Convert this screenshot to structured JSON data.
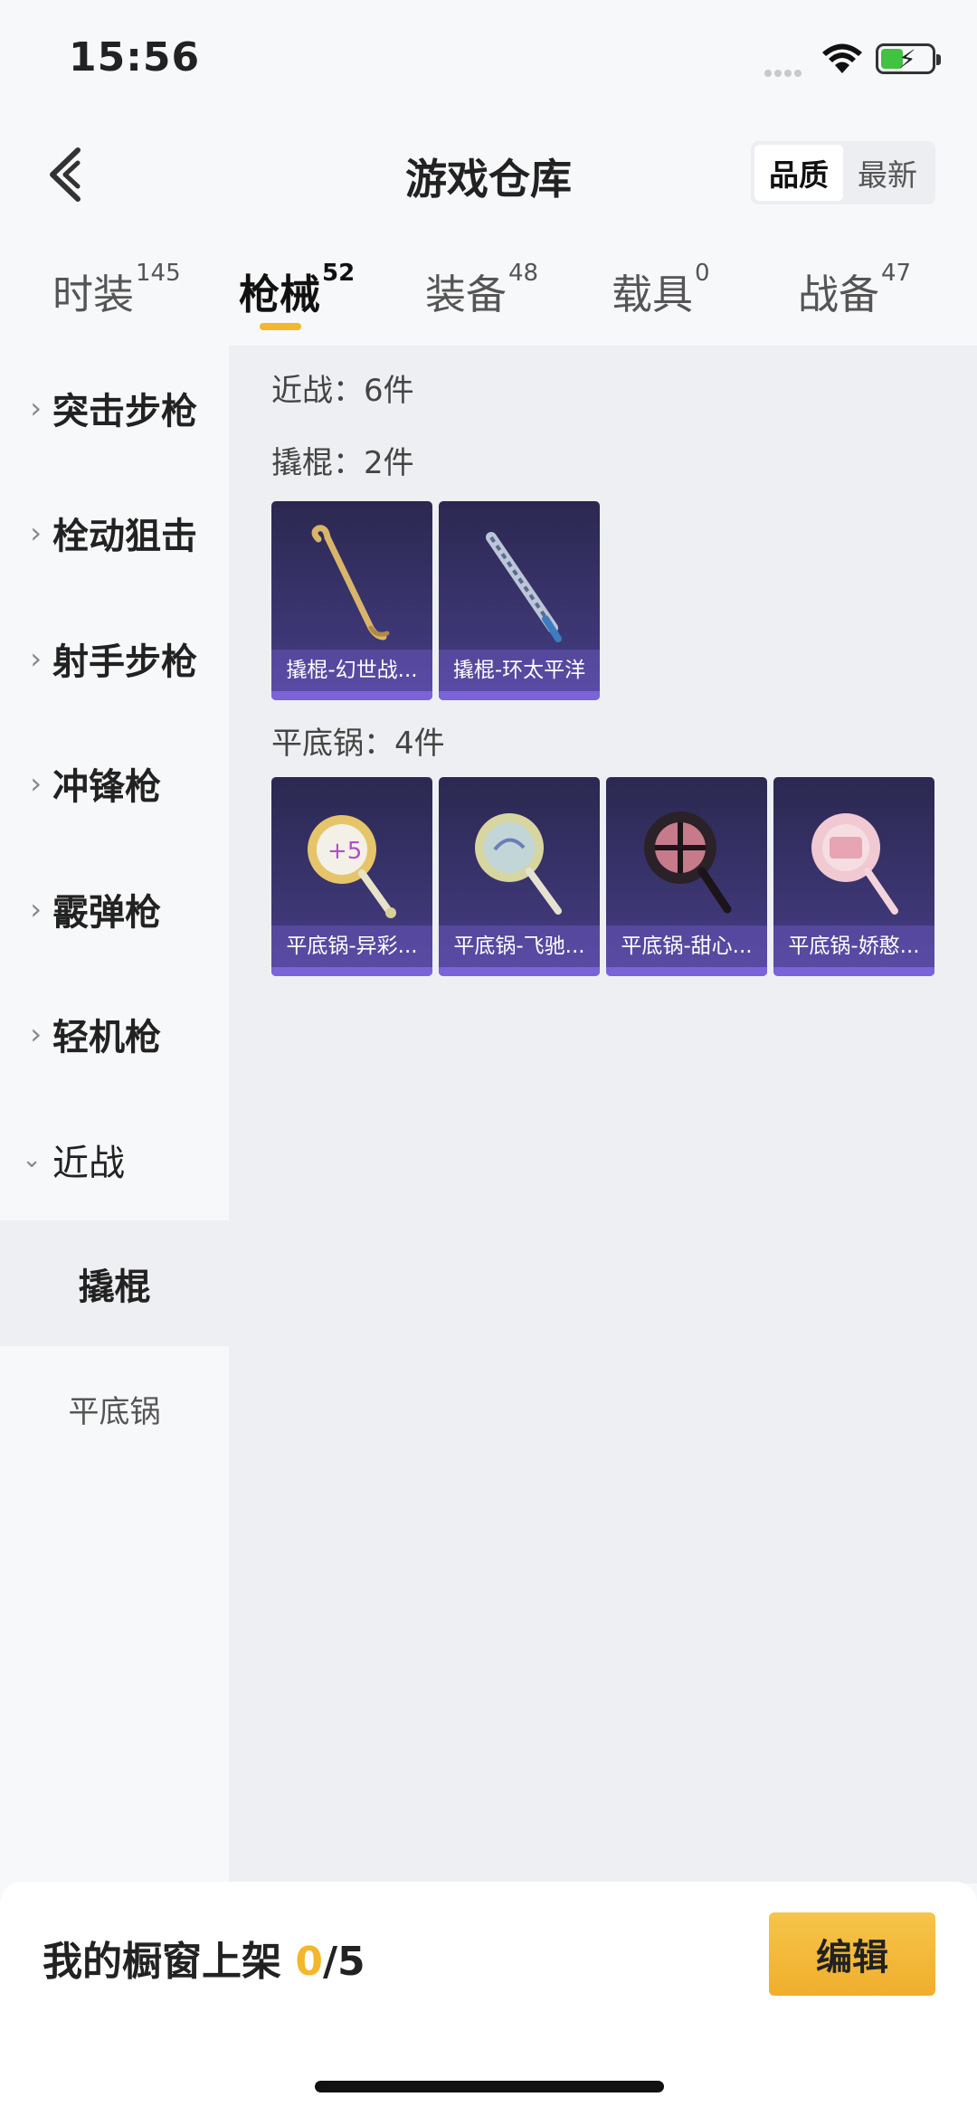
{
  "status_bar": {
    "time": "15:56"
  },
  "header": {
    "title": "游戏仓库",
    "sort": {
      "quality": "品质",
      "newest": "最新",
      "selected": "品质"
    }
  },
  "tabs": [
    {
      "label": "时装",
      "count": "145"
    },
    {
      "label": "枪械",
      "count": "52",
      "active": true
    },
    {
      "label": "装备",
      "count": "48"
    },
    {
      "label": "载具",
      "count": "0"
    },
    {
      "label": "战备",
      "count": "47"
    }
  ],
  "sidebar": {
    "categories": [
      "突击步枪",
      "栓动狙击",
      "射手步枪",
      "冲锋枪",
      "霰弹枪",
      "轻机枪",
      "近战"
    ],
    "subcategories": [
      "撬棍",
      "平底锅"
    ],
    "active_sub": "撬棍"
  },
  "content": {
    "melee_header": "近战：6件",
    "crowbar_header": "撬棍：2件",
    "pan_header": "平底锅：4件",
    "crowbars": [
      "撬棍-幻世战...",
      "撬棍-环太平洋"
    ],
    "pans": [
      "平底锅-异彩...",
      "平底锅-飞驰...",
      "平底锅-甜心...",
      "平底锅-娇憨..."
    ]
  },
  "footer": {
    "shelf_label": "我的橱窗上架",
    "shelf_current": "0",
    "shelf_total": "/5",
    "edit_label": "编辑"
  },
  "colors": {
    "accent": "#f4b62b",
    "card_bg": "#3e3776"
  }
}
